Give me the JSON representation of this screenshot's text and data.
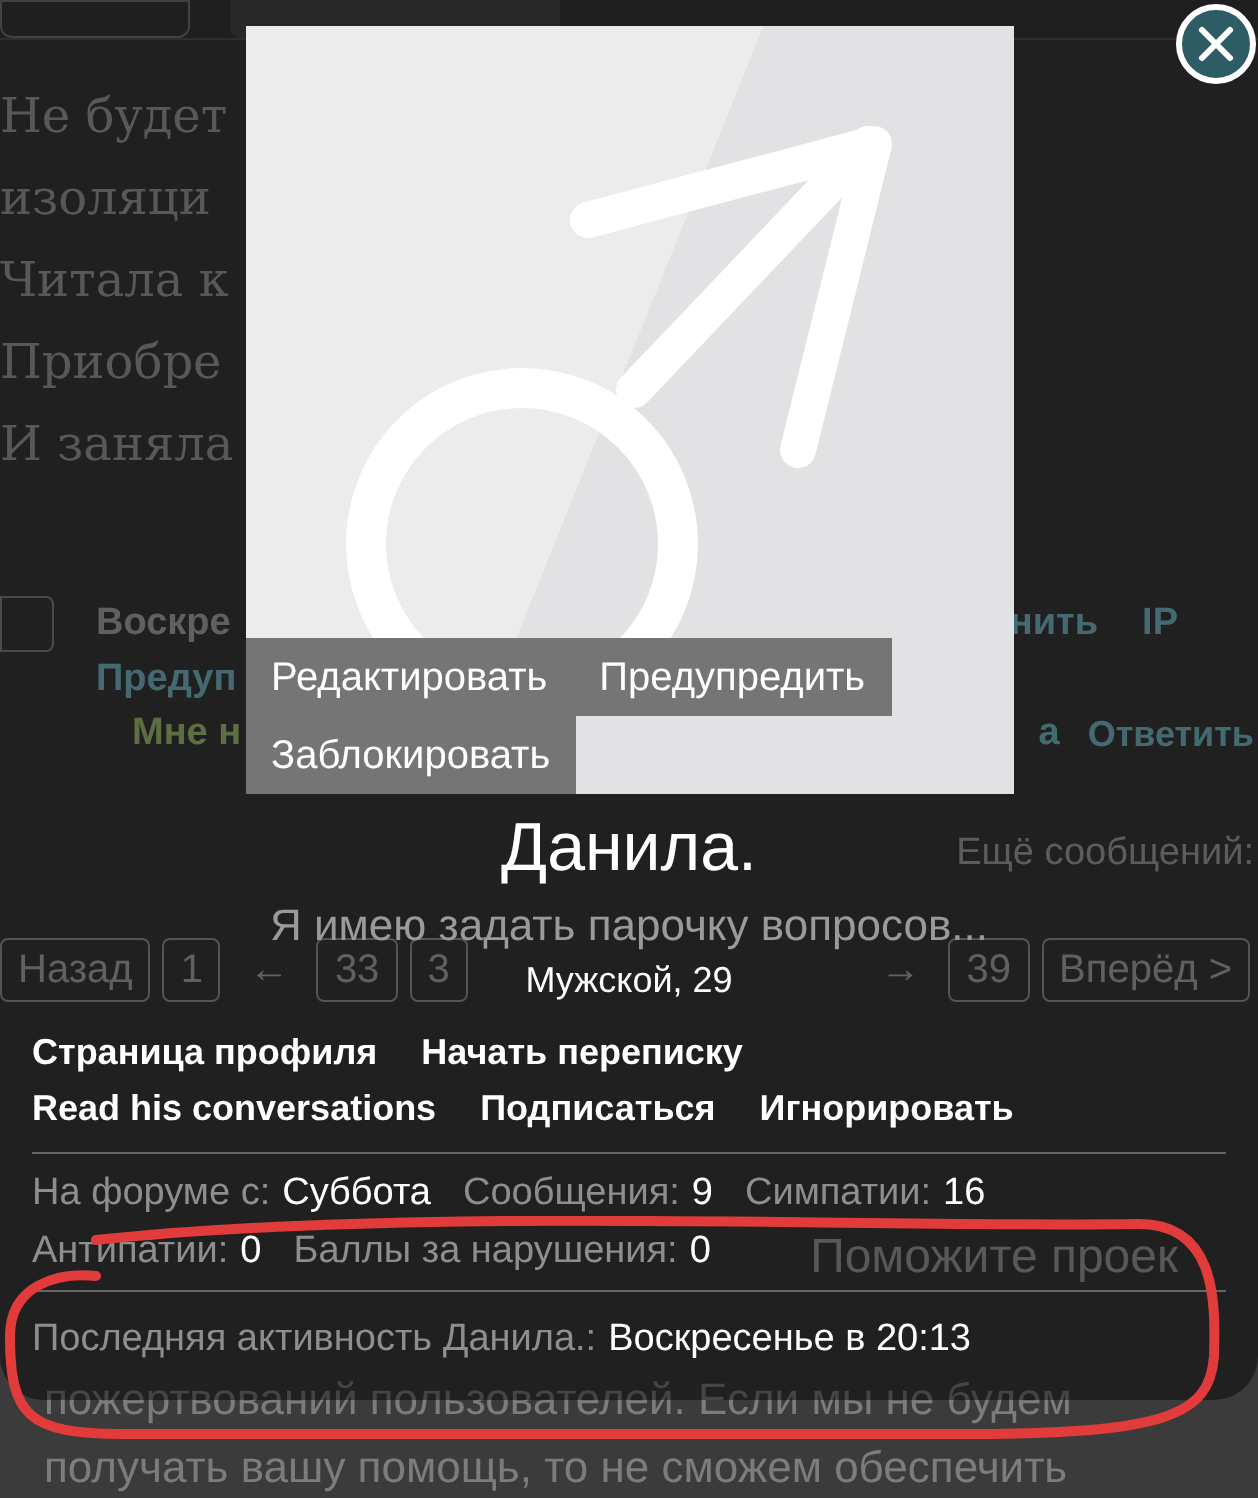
{
  "background_page": {
    "checkbox": {
      "checked": false
    },
    "text_lines": [
      "Не будет",
      "изоляци",
      "Читала к",
      "Приобре",
      "И заняла"
    ],
    "post_meta": {
      "date": "Воскре",
      "link_right": "нить",
      "ip": "IP",
      "warn": "Предуп",
      "like": "Мне н",
      "fragment": "а",
      "reply": "Ответить"
    },
    "more_messages": "Ещё сообщений:",
    "pagination_left": [
      {
        "label": "Назад",
        "kind": "button"
      },
      {
        "label": "1",
        "kind": "button"
      },
      {
        "label": "←",
        "kind": "arrow"
      },
      {
        "label": "33",
        "kind": "button"
      },
      {
        "label": "3",
        "kind": "button"
      }
    ],
    "pagination_right": [
      {
        "label": "→",
        "kind": "arrow"
      },
      {
        "label": "39",
        "kind": "button"
      },
      {
        "label": "Вперёд >",
        "kind": "button"
      }
    ],
    "side_fragment": "Поможите проек",
    "bottom_lines": [
      "пожертвований пользователей. Если мы не будем",
      "получать вашу помощь, то не сможем обеспечить"
    ]
  },
  "profile_popup": {
    "avatar_actions": [
      "Редактировать",
      "Предупредить",
      "Заблокировать"
    ],
    "name": "Данила.",
    "status": "Я имею задать парочку вопросов...",
    "gender_age": "Мужской, 29",
    "links": [
      [
        "Страница профиля",
        "Начать переписку"
      ],
      [
        "Read his conversations",
        "Подписаться",
        "Игнорировать"
      ]
    ],
    "stats": [
      [
        {
          "label": "На форуме с:",
          "value": "Суббота"
        },
        {
          "label": "Сообщения:",
          "value": "9"
        },
        {
          "label": "Симпатии:",
          "value": "16"
        }
      ],
      [
        {
          "label": "Антипатии:",
          "value": "0"
        },
        {
          "label": "Баллы за нарушения:",
          "value": "0"
        }
      ]
    ],
    "last_activity": {
      "label": "Последняя активность Данила.:",
      "value": "Воскресенье в 20:13"
    }
  }
}
